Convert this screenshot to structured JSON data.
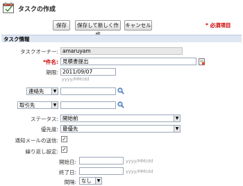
{
  "header": {
    "title": "タスクの作成"
  },
  "toolbar": {
    "save": "保存",
    "save_new": "保存して新しく作成",
    "cancel": "キャンセル"
  },
  "required_note": "* 必須項目",
  "section": {
    "title": "タスク情報"
  },
  "form": {
    "owner_label": "タスクオーナー:",
    "owner_value": "amaruyam",
    "subject_label": "*件名:",
    "subject_value": "見積書提出",
    "due_label": "期限:",
    "due_value": "2011/09/07",
    "due_hint": "yyyy/MM/dd",
    "contact_select": "連絡先",
    "related_select": "取引先",
    "status_label": "ステータス:",
    "status_value": "開始前",
    "priority_label": "優先度:",
    "priority_value": "最優先",
    "notify_label": "通知メールの送信:",
    "repeat_label": "繰り返し設定:",
    "start_label": "開始日:",
    "start_hint": "yyyy/MM/dd",
    "end_label": "終了日:",
    "end_hint": "yyyy/MM/dd",
    "interval_label": "間隔:",
    "interval_value": "なし"
  }
}
